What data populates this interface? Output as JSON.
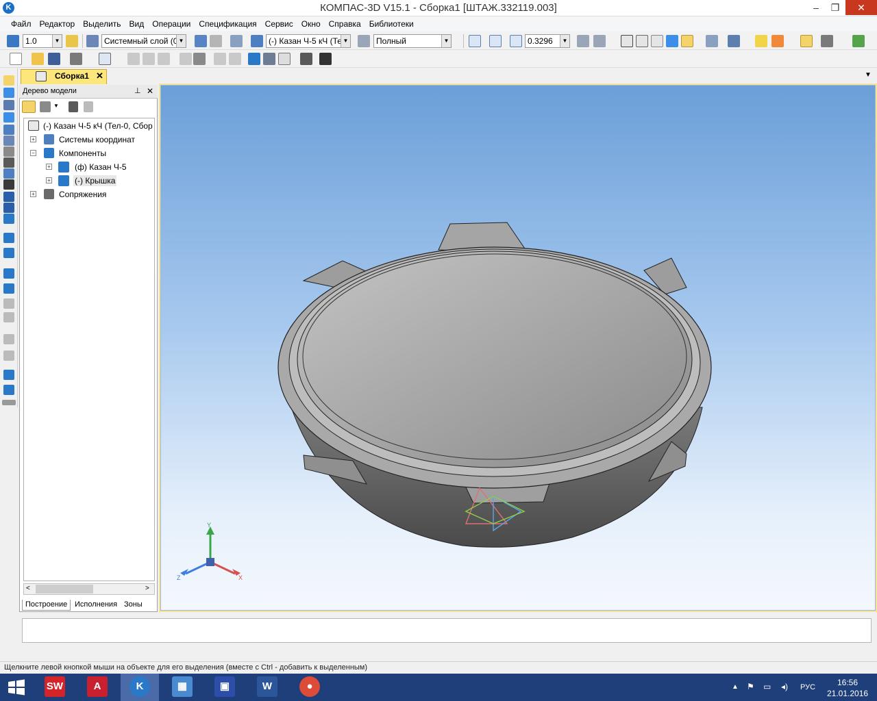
{
  "window": {
    "title": "КОМПАС-3D V15.1 - Сборка1 [ШТАЖ.332119.003]",
    "logo": "K"
  },
  "menu": [
    "Файл",
    "Редактор",
    "Выделить",
    "Вид",
    "Операции",
    "Спецификация",
    "Сервис",
    "Окно",
    "Справка",
    "Библиотеки"
  ],
  "toolbar": {
    "scale": "1.0",
    "layer": "Системный слой (0)",
    "component": "(-) Казан Ч-5 кЧ (Те",
    "view_mode": "Полный",
    "zoom": "0.3296"
  },
  "document": {
    "tab_label": "Сборка1",
    "close": "✕"
  },
  "tree_panel": {
    "title": "Дерево модели",
    "pin": "▾",
    "close": "✕",
    "root": "(-) Казан Ч-5 кЧ (Тел-0, Сбор",
    "items": [
      {
        "label": "Системы координат"
      },
      {
        "label": "Компоненты"
      },
      {
        "label": "(ф) Казан Ч-5"
      },
      {
        "label": "(-) Крышка"
      },
      {
        "label": "Сопряжения"
      }
    ],
    "tabs": [
      "Построение",
      "Исполнения",
      "Зоны"
    ]
  },
  "axes": {
    "x": "X",
    "y": "Y",
    "z": "Z"
  },
  "status": "Щелкните левой кнопкой мыши на объекте для его выделения (вместе с Ctrl - добавить к выделенным)",
  "taskbar": {
    "apps": [
      {
        "name": "SolidWorks",
        "glyph": "SW",
        "color": "#d5232a"
      },
      {
        "name": "AutoCAD",
        "glyph": "A",
        "color": "#c8202f"
      },
      {
        "name": "KOMPAS",
        "glyph": "K",
        "color": "#2a79c8"
      },
      {
        "name": "Calculator",
        "glyph": "▦",
        "color": "#4a8ad1"
      },
      {
        "name": "Save",
        "glyph": "▣",
        "color": "#2c4ea8"
      },
      {
        "name": "Word",
        "glyph": "W",
        "color": "#2b579a"
      },
      {
        "name": "Chrome",
        "glyph": "●",
        "color": "#dd4b39"
      }
    ],
    "lang": "РУС",
    "time": "16:56",
    "date": "21.01.2016"
  },
  "colors": {
    "accent": "#fde67a",
    "viewport_top": "#6b9fd8",
    "model_gray": "#9a9a9a"
  }
}
